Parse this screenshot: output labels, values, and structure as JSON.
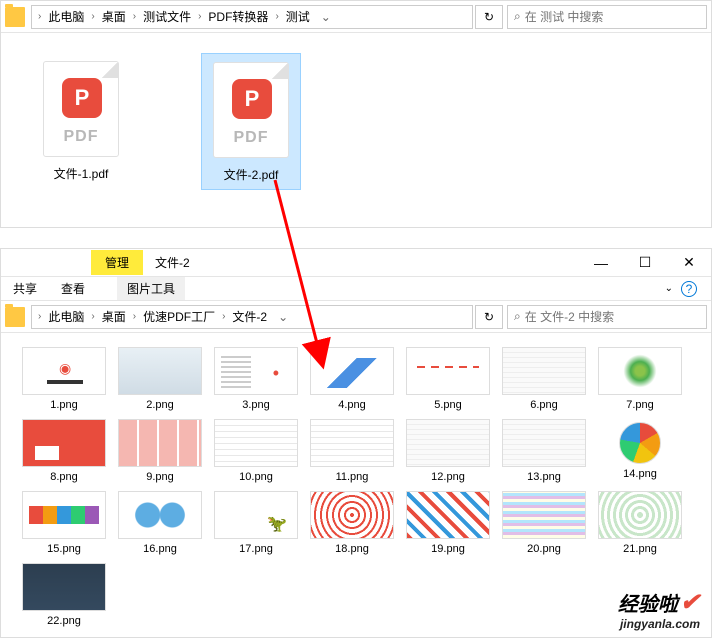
{
  "top": {
    "breadcrumb": [
      "此电脑",
      "桌面",
      "测试文件",
      "PDF转换器",
      "测试"
    ],
    "search_placeholder": "在 测试 中搜索",
    "files": [
      {
        "name": "文件-1.pdf",
        "selected": false
      },
      {
        "name": "文件-2.pdf",
        "selected": true
      }
    ],
    "pdf_label": "PDF"
  },
  "bottom": {
    "tab_manage": "管理",
    "tab_name": "文件-2",
    "share": "共享",
    "view": "查看",
    "pic_tools": "图片工具",
    "breadcrumb": [
      "此电脑",
      "桌面",
      "优速PDF工厂",
      "文件-2"
    ],
    "search_placeholder": "在 文件-2 中搜索",
    "thumbs": [
      "1.png",
      "2.png",
      "3.png",
      "4.png",
      "5.png",
      "6.png",
      "7.png",
      "8.png",
      "9.png",
      "10.png",
      "11.png",
      "12.png",
      "13.png",
      "14.png",
      "15.png",
      "16.png",
      "17.png",
      "18.png",
      "19.png",
      "20.png",
      "21.png",
      "22.png"
    ]
  },
  "watermark": {
    "main": "经验啦",
    "sub": "jingyanla.com"
  },
  "icons": {
    "refresh": "↻",
    "search": "🔍",
    "minimize": "—",
    "maximize": "☐",
    "close": "✕",
    "chev": "›",
    "dropdown": "⌄",
    "help": "?",
    "expand": "⌄",
    "p": "P"
  }
}
